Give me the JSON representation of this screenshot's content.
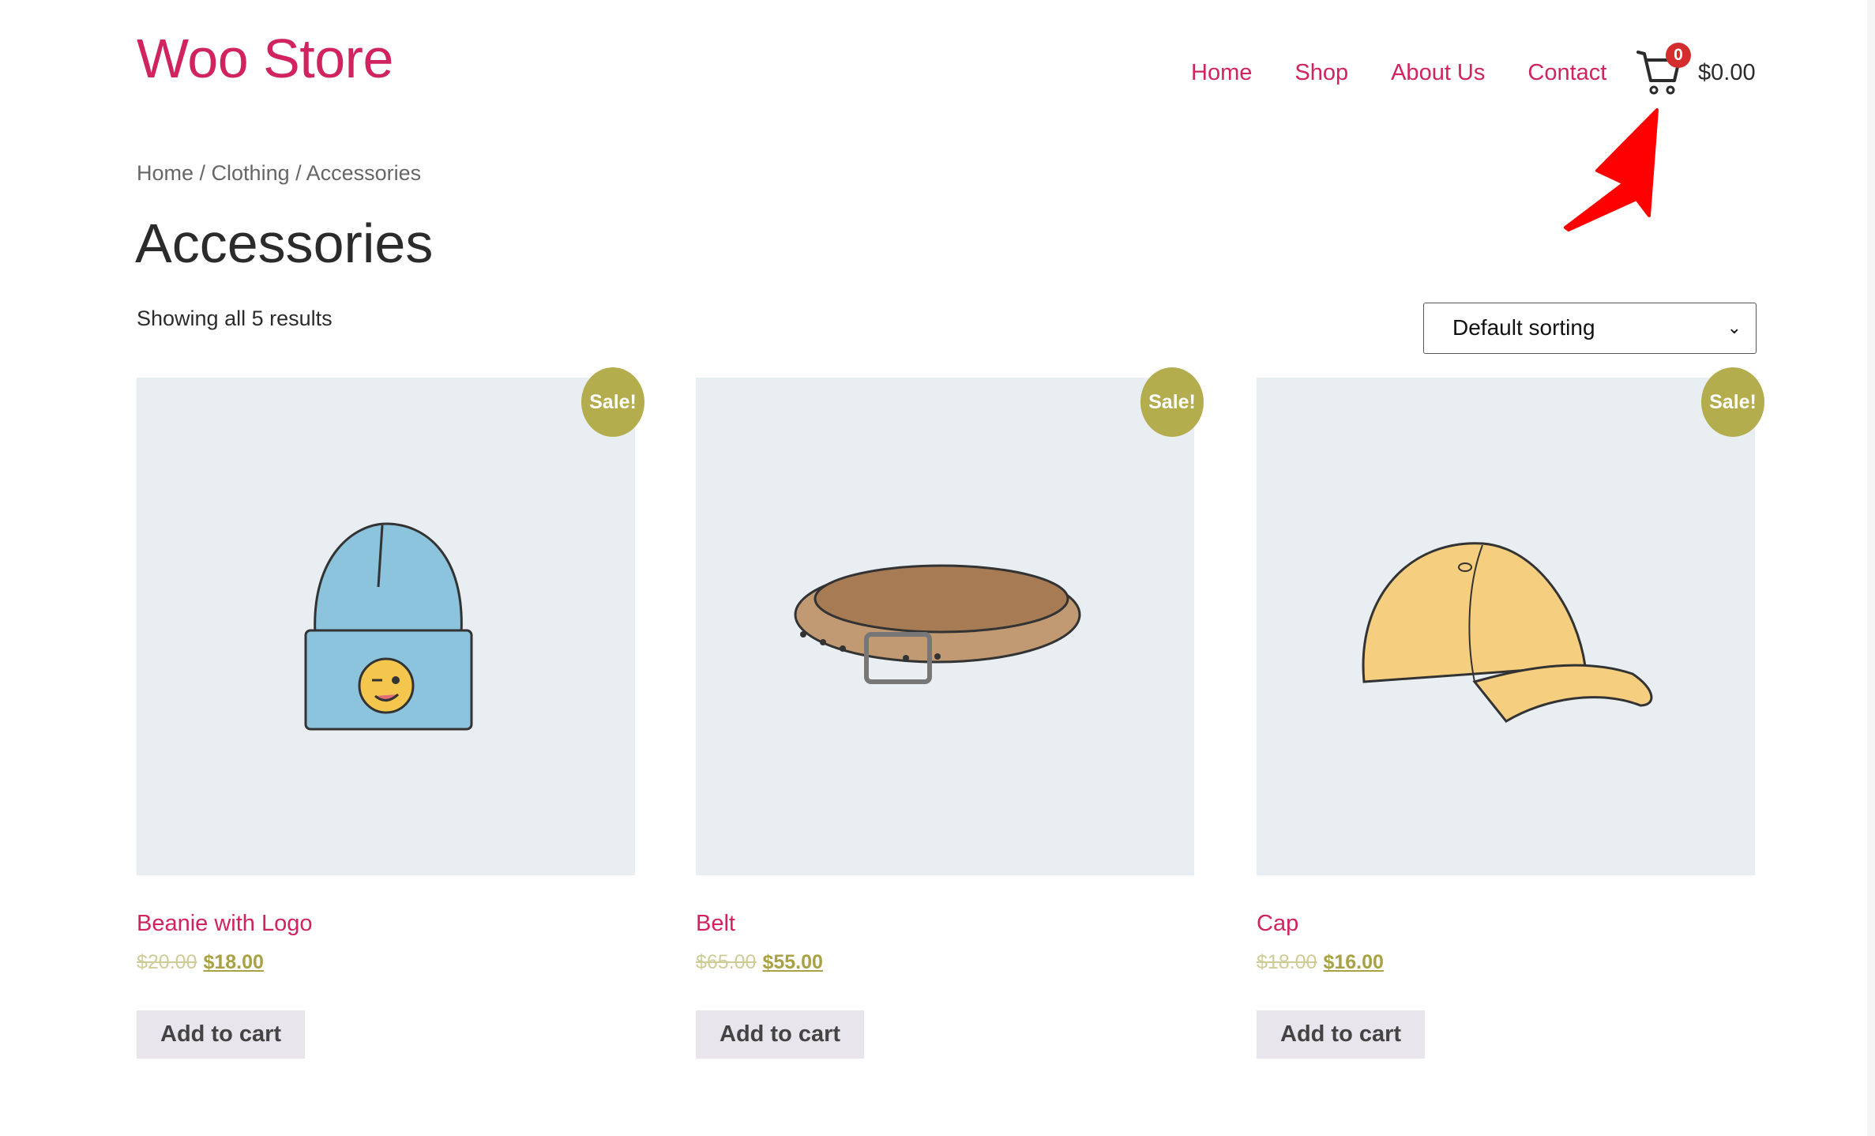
{
  "site": {
    "title": "Woo Store"
  },
  "nav": {
    "items": [
      "Home",
      "Shop",
      "About Us",
      "Contact"
    ]
  },
  "cart": {
    "count": "0",
    "total": "$0.00",
    "icon": "cart-icon"
  },
  "breadcrumb": {
    "items": [
      "Home",
      "Clothing",
      "Accessories"
    ],
    "separator": " / "
  },
  "page": {
    "title": "Accessories",
    "result_count": "Showing all 5 results"
  },
  "sort": {
    "selected": "Default sorting"
  },
  "colors": {
    "brand": "#d1235f",
    "sale": "#b3ad4e",
    "annotation_arrow": "#ff0000"
  },
  "products": [
    {
      "name": "Beanie with Logo",
      "regular_price": "$20.00",
      "sale_price": "$18.00",
      "badge": "Sale!",
      "button": "Add to cart"
    },
    {
      "name": "Belt",
      "regular_price": "$65.00",
      "sale_price": "$55.00",
      "badge": "Sale!",
      "button": "Add to cart"
    },
    {
      "name": "Cap",
      "regular_price": "$18.00",
      "sale_price": "$16.00",
      "badge": "Sale!",
      "button": "Add to cart"
    }
  ]
}
